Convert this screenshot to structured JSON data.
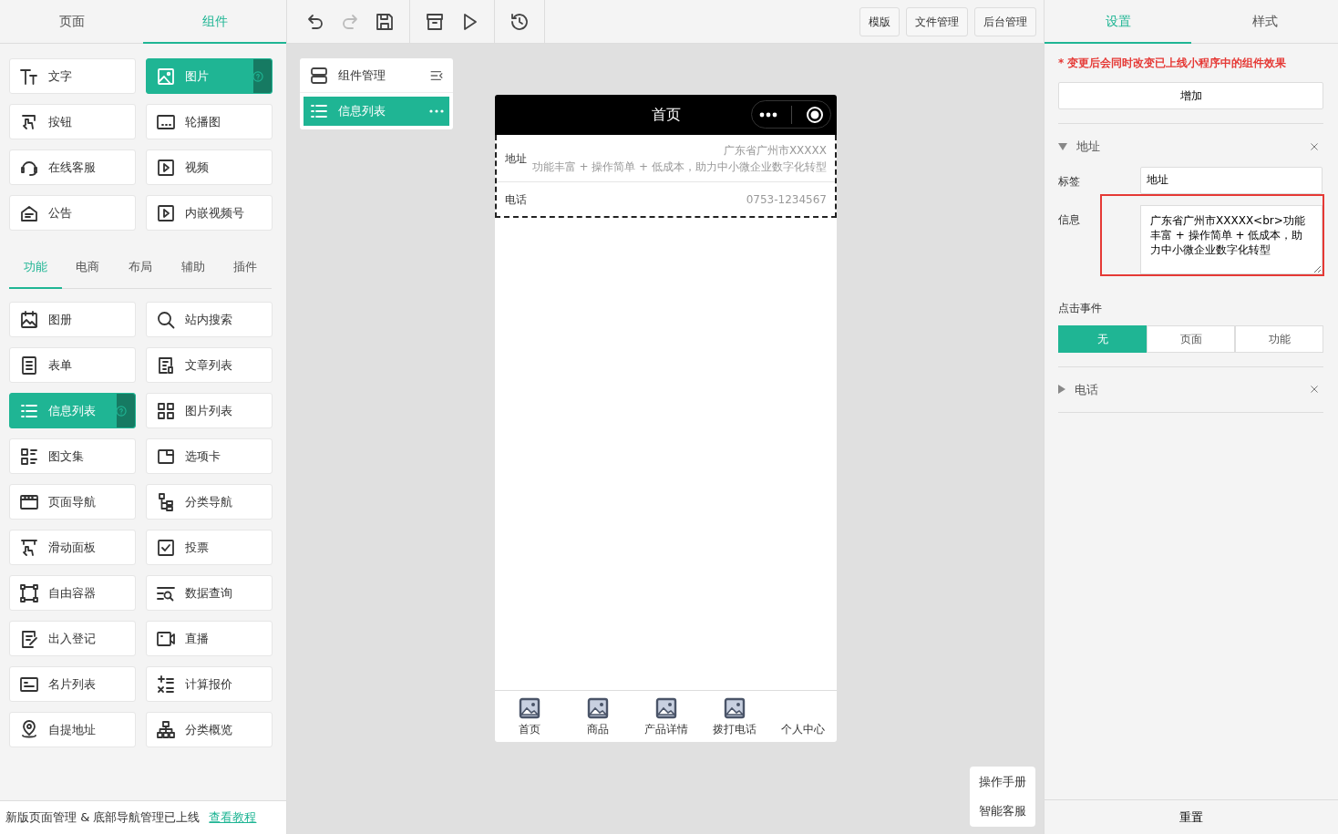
{
  "left_tabs": [
    {
      "label": "页面",
      "selected": false
    },
    {
      "label": "组件",
      "selected": true
    }
  ],
  "basic_components": [
    {
      "label": "文字",
      "selected": false
    },
    {
      "label": "图片",
      "selected": true
    },
    {
      "label": "按钮",
      "selected": false
    },
    {
      "label": "轮播图",
      "selected": false
    },
    {
      "label": "在线客服",
      "selected": false
    },
    {
      "label": "视频",
      "selected": false
    },
    {
      "label": "公告",
      "selected": false
    },
    {
      "label": "内嵌视频号",
      "selected": false
    }
  ],
  "category_tabs": [
    {
      "label": "功能",
      "selected": true
    },
    {
      "label": "电商",
      "selected": false
    },
    {
      "label": "布局",
      "selected": false
    },
    {
      "label": "辅助",
      "selected": false
    },
    {
      "label": "插件",
      "selected": false
    }
  ],
  "feature_components": [
    {
      "label": "图册",
      "selected": false
    },
    {
      "label": "站内搜索",
      "selected": false
    },
    {
      "label": "表单",
      "selected": false
    },
    {
      "label": "文章列表",
      "selected": false
    },
    {
      "label": "信息列表",
      "selected": true
    },
    {
      "label": "图片列表",
      "selected": false
    },
    {
      "label": "图文集",
      "selected": false
    },
    {
      "label": "选项卡",
      "selected": false
    },
    {
      "label": "页面导航",
      "selected": false
    },
    {
      "label": "分类导航",
      "selected": false
    },
    {
      "label": "滑动面板",
      "selected": false
    },
    {
      "label": "投票",
      "selected": false
    },
    {
      "label": "自由容器",
      "selected": false
    },
    {
      "label": "数据查询",
      "selected": false
    },
    {
      "label": "出入登记",
      "selected": false
    },
    {
      "label": "直播",
      "selected": false
    },
    {
      "label": "名片列表",
      "selected": false
    },
    {
      "label": "计算报价",
      "selected": false
    },
    {
      "label": "自提地址",
      "selected": false
    },
    {
      "label": "分类概览",
      "selected": false
    }
  ],
  "notice": {
    "text": "新版页面管理 & 底部导航管理已上线",
    "link": "查看教程"
  },
  "toolbar": {
    "buttons": [
      "模版",
      "文件管理",
      "后台管理"
    ]
  },
  "component_panel": {
    "title": "组件管理",
    "items": [
      {
        "label": "信息列表",
        "selected": true
      }
    ]
  },
  "phone": {
    "title": "首页",
    "rows": [
      {
        "label": "地址",
        "lines": [
          "广东省广州市XXXXX",
          "功能丰富 + 操作简单 + 低成本，助力中小微企业数字化转型"
        ]
      },
      {
        "label": "电话",
        "lines": [
          "0753-1234567"
        ]
      }
    ],
    "tabbar": [
      {
        "label": "首页",
        "icon": true
      },
      {
        "label": "商品",
        "icon": true
      },
      {
        "label": "产品详情",
        "icon": true
      },
      {
        "label": "拨打电话",
        "icon": true
      },
      {
        "label": "个人中心",
        "icon": false
      }
    ]
  },
  "help": [
    "操作手册",
    "智能客服"
  ],
  "settings": {
    "tabs": [
      {
        "label": "设置",
        "selected": true
      },
      {
        "label": "样式",
        "selected": false
      }
    ],
    "warning": "* 变更后会同时改变已上线小程序中的组件效果",
    "add_button": "增加",
    "groups": [
      {
        "title": "地址",
        "expanded": true,
        "fields": [
          {
            "label": "标签",
            "kind": "input",
            "value": "地址",
            "highlighted": false
          },
          {
            "label": "信息",
            "kind": "textarea",
            "value": "广东省广州市XXXXX<br>功能丰富 + 操作简单 + 低成本，助力中小微企业数字化转型",
            "highlighted": true
          }
        ],
        "click_event": {
          "label": "点击事件",
          "options": [
            {
              "label": "无",
              "selected": true
            },
            {
              "label": "页面",
              "selected": false
            },
            {
              "label": "功能",
              "selected": false
            }
          ]
        }
      },
      {
        "title": "电话",
        "expanded": false
      }
    ],
    "reset": "重置"
  }
}
